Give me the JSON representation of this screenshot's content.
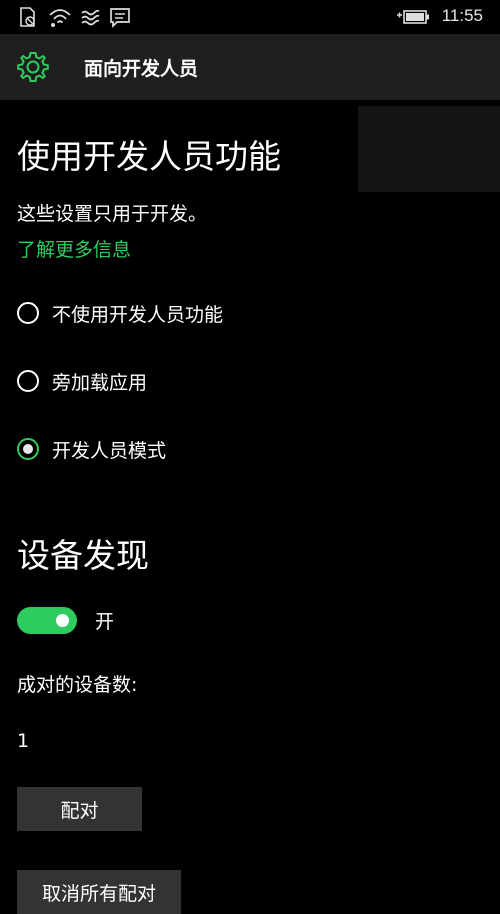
{
  "status_bar": {
    "time": "11:55",
    "icons": [
      "no-sim-icon",
      "wifi-icon",
      "signal-wave-icon",
      "message-icon",
      "battery-charging-icon"
    ]
  },
  "header": {
    "title": "面向开发人员",
    "icon": "gear-icon"
  },
  "developer_features": {
    "title": "使用开发人员功能",
    "description": "这些设置只用于开发。",
    "learn_more": "了解更多信息",
    "options": [
      {
        "label": "不使用开发人员功能",
        "checked": false
      },
      {
        "label": "旁加载应用",
        "checked": false
      },
      {
        "label": "开发人员模式",
        "checked": true
      }
    ]
  },
  "device_discovery": {
    "title": "设备发现",
    "toggle_label": "开",
    "toggle_on": true,
    "paired_count_label": "成对的设备数:",
    "paired_count": "1",
    "pair_button": "配对",
    "unpair_all_button": "取消所有配对"
  },
  "colors": {
    "accent": "#2ecc5e",
    "background": "#000000",
    "header_bg": "#1f1f1f",
    "button_bg": "#333333"
  }
}
